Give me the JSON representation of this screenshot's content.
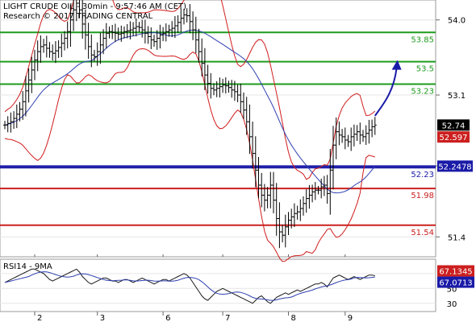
{
  "header": {
    "title": "LIGHT CRUDE OIL - 30min - 9:57:46 AM (CET)",
    "subtitle": "Research © 2017 TRADING CENTRAL"
  },
  "chart_data": {
    "type": "candlestick",
    "ylim": [
      51.2,
      54.2
    ],
    "price_ticks": [
      {
        "value": 54.0,
        "label": "54.0"
      },
      {
        "value": 53.1,
        "label": "53.1"
      },
      {
        "value": 52.25,
        "label": "52.25"
      },
      {
        "value": 51.4,
        "label": "51.4"
      }
    ],
    "levels": [
      {
        "value": 53.85,
        "label": "53.85",
        "color": "#1e9b1e",
        "label_box": false
      },
      {
        "value": 53.5,
        "label": "53.5",
        "color": "#1e9b1e",
        "label_box": false
      },
      {
        "value": 53.23,
        "label": "53.23",
        "color": "#1e9b1e",
        "label_box": false
      },
      {
        "value": 52.2478,
        "label": "52.2478",
        "color": "#1a1aa8",
        "label_box": true
      },
      {
        "value": 52.23,
        "label": "52.23",
        "color": "#1a1aa8",
        "label_box": false
      },
      {
        "value": 51.98,
        "label": "51.98",
        "color": "#cc1f1f",
        "label_box": false
      },
      {
        "value": 51.54,
        "label": "51.54",
        "color": "#cc1f1f",
        "label_box": false
      }
    ],
    "last_price": {
      "value": 52.74,
      "label": "52.74"
    },
    "ma_value": {
      "value": 52.597,
      "label": "52.597"
    },
    "x_ticks": [
      {
        "index": 10,
        "label": "2"
      },
      {
        "index": 31,
        "label": "3"
      },
      {
        "index": 53,
        "label": "6"
      },
      {
        "index": 73,
        "label": "7"
      },
      {
        "index": 95,
        "label": "8"
      },
      {
        "index": 114,
        "label": "9"
      }
    ],
    "forecast_arrow": {
      "from_index": 124,
      "from_value": 52.85,
      "to_index": 128,
      "to_value": 53.5
    },
    "closes": [
      52.74,
      52.76,
      52.78,
      52.82,
      52.87,
      52.93,
      53.02,
      53.15,
      53.28,
      53.4,
      53.52,
      53.62,
      53.68,
      53.7,
      53.66,
      53.62,
      53.6,
      53.63,
      53.67,
      53.72,
      53.78,
      53.86,
      54.0,
      54.12,
      54.2,
      54.12,
      53.95,
      53.82,
      53.68,
      53.58,
      53.56,
      53.62,
      53.7,
      53.78,
      53.84,
      53.86,
      53.85,
      53.84,
      53.83,
      53.84,
      53.86,
      53.87,
      53.88,
      53.9,
      53.92,
      53.91,
      53.88,
      53.84,
      53.8,
      53.76,
      53.74,
      53.78,
      53.82,
      53.84,
      53.86,
      53.88,
      53.9,
      53.93,
      53.97,
      54.02,
      54.06,
      54.05,
      53.98,
      53.88,
      53.76,
      53.62,
      53.48,
      53.34,
      53.24,
      53.18,
      53.16,
      53.18,
      53.2,
      53.22,
      53.21,
      53.19,
      53.16,
      53.14,
      53.1,
      53.02,
      52.92,
      52.78,
      52.6,
      52.4,
      52.2,
      52.02,
      51.9,
      51.84,
      51.9,
      52.02,
      51.84,
      51.62,
      51.46,
      51.42,
      51.52,
      51.6,
      51.64,
      51.68,
      51.7,
      51.74,
      51.8,
      51.86,
      51.9,
      51.94,
      51.96,
      51.96,
      52.0,
      52.02,
      51.92,
      52.2,
      52.5,
      52.66,
      52.62,
      52.6,
      52.56,
      52.54,
      52.6,
      52.63,
      52.66,
      52.62,
      52.6,
      52.64,
      52.68,
      52.72,
      52.74
    ],
    "rsi": {
      "label": "RSI14 - 9MA",
      "ylim": [
        20,
        85
      ],
      "ticks": [
        {
          "value": 70,
          "label": "70"
        },
        {
          "value": 50,
          "label": "50"
        },
        {
          "value": 30,
          "label": "30"
        }
      ],
      "rsi_value": {
        "value": 67.1345,
        "label": "67.1345"
      },
      "ma_value": {
        "value": 67.0713,
        "label": "67.0713"
      },
      "values": [
        58,
        60,
        62,
        64,
        66,
        68,
        70,
        72,
        74,
        76,
        76,
        74,
        72,
        70,
        66,
        62,
        60,
        62,
        64,
        66,
        68,
        70,
        72,
        74,
        76,
        72,
        66,
        62,
        58,
        56,
        58,
        60,
        62,
        64,
        64,
        62,
        60,
        60,
        58,
        60,
        62,
        62,
        60,
        58,
        60,
        62,
        64,
        62,
        60,
        58,
        56,
        58,
        60,
        62,
        62,
        60,
        62,
        64,
        66,
        68,
        70,
        68,
        64,
        58,
        52,
        46,
        40,
        36,
        34,
        38,
        42,
        46,
        48,
        50,
        48,
        46,
        44,
        42,
        40,
        38,
        36,
        34,
        32,
        30,
        34,
        38,
        40,
        36,
        32,
        30,
        34,
        38,
        40,
        42,
        44,
        42,
        44,
        46,
        48,
        46,
        48,
        50,
        52,
        54,
        56,
        56,
        58,
        56,
        52,
        58,
        64,
        66,
        68,
        66,
        64,
        62,
        64,
        66,
        64,
        62,
        64,
        66,
        68,
        68,
        67
      ]
    }
  }
}
